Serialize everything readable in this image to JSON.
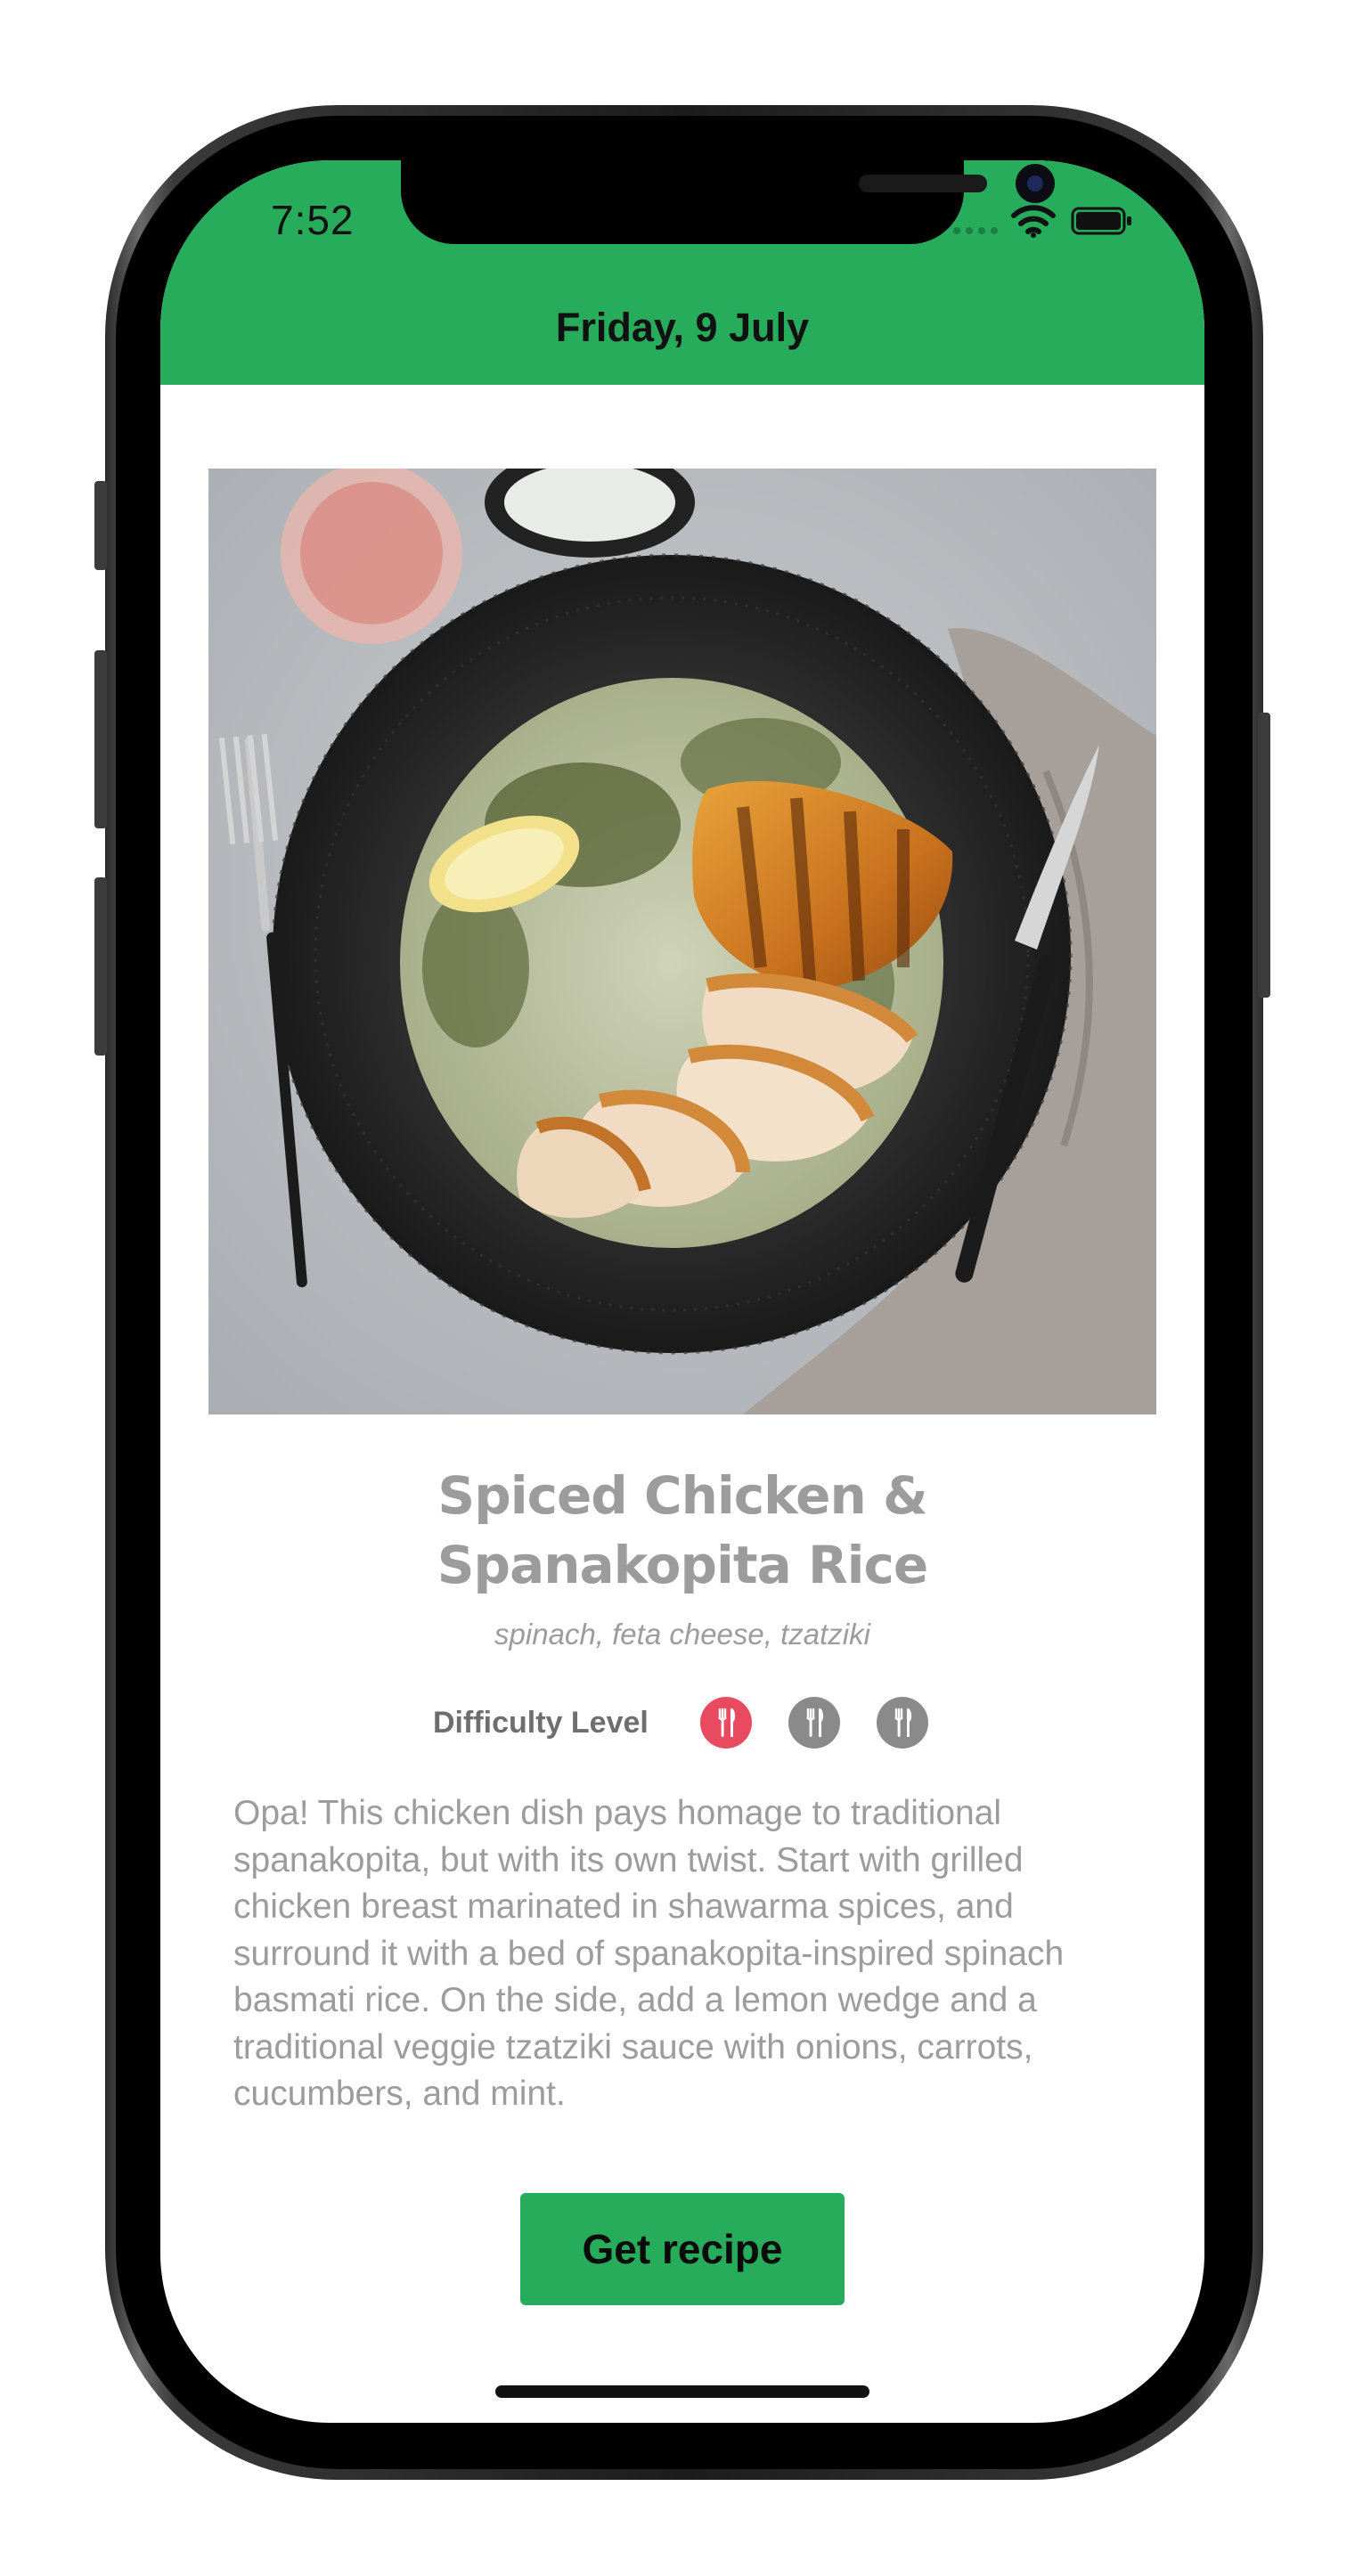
{
  "status_bar": {
    "time": "7:52"
  },
  "header": {
    "date": "Friday, 9 July",
    "background_color": "#27ac5c"
  },
  "recipe": {
    "title_line1": "Spiced Chicken &",
    "title_line2": "Spanakopita Rice",
    "subtitle": "spinach, feta cheese, tzatziki",
    "difficulty_label": "Difficulty Level",
    "difficulty_level": 1,
    "difficulty_max": 3,
    "difficulty_active_color": "#e84a5f",
    "difficulty_inactive_color": "#8a8a8a",
    "description": "Opa! This chicken dish pays homage to traditional spanakopita, but with its own twist. Start with grilled chicken breast marinated in shawarma spices, and surround it with a bed of spanakopita-inspired spinach basmati rice. On the side, add a lemon wedge and a traditional veggie tzatziki sauce with onions, carrots, cucumbers, and mint.",
    "button_label": "Get recipe"
  },
  "icons": [
    "signal-icon",
    "wifi-icon",
    "battery-icon",
    "utensils-icon"
  ]
}
